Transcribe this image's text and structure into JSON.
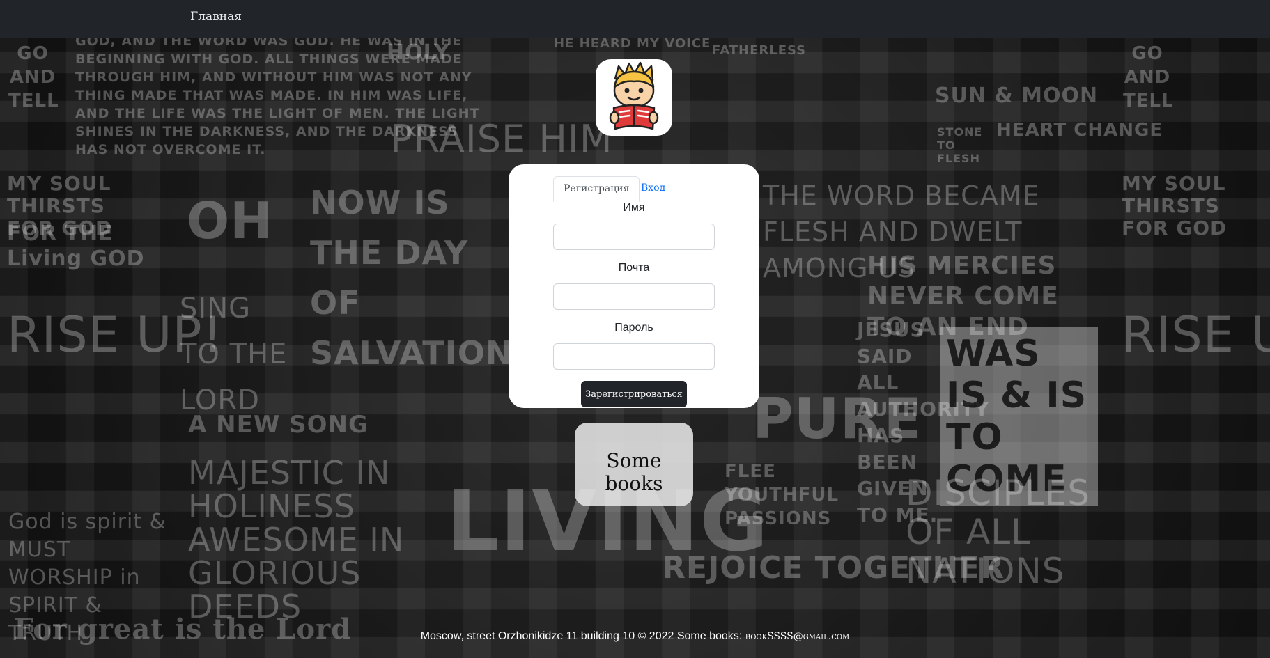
{
  "navbar": {
    "home_label": "Главная"
  },
  "background_text": [
    "GO AND TELL",
    "GOD, AND THE WORD WAS GOD. HE WAS IN THE",
    "BEGINNING WITH GOD. ALL THINGS WERE MADE",
    "THROUGH HIM, AND WITHOUT HIM WAS NOT ANY",
    "THING MADE THAT WAS MADE. IN HIM WAS LIFE,",
    "AND THE LIFE WAS THE LIGHT OF MEN. THE LIGHT",
    "SHINES IN THE DARKNESS, AND THE DARKNESS",
    "HAS NOT OVERCOME IT.",
    "HOLY",
    "HE HEARD MY VOICE",
    "FATHERLESS",
    "PRAISE HIM",
    "SUN & MOON",
    "HEART CHANGE",
    "STONE TO FLESH",
    "MY SOUL THIRSTS FOR GOD",
    "FOR THE Living GOD",
    "OH",
    "NOW IS THE DAY OF SALVATION",
    "THE WORD BECAME FLESH AND DWELT AMONG US",
    "HIS MERCIES NEVER COME TO AN END",
    "RISE UP!",
    "SING TO THE LORD",
    "A NEW SONG",
    "JESUS SAID ALL AUTHORITY HAS BEEN GIVEN TO ME.",
    "WAS IS & IS TO COME",
    "PURE",
    "MAJESTIC IN HOLINESS AWESOME IN GLORIOUS DEEDS",
    "LIVING",
    "FLEE YOUTHFUL PASSIONS",
    "REJOICE TOGETHER",
    "DISCIPLES OF ALL NATIONS",
    "God is spirit & MUST WORSHIP in SPIRIT & TRUTH",
    "For great is the Lord"
  ],
  "form": {
    "tabs": [
      {
        "label": "Регистрация",
        "active": true
      },
      {
        "label": "Вход",
        "active": false
      }
    ],
    "fields": [
      {
        "label": "Имя",
        "value": ""
      },
      {
        "label": "Почта",
        "value": ""
      },
      {
        "label": "Пароль",
        "value": ""
      }
    ],
    "submit_label": "Зарегистрироваться"
  },
  "brand": {
    "name": "Some books"
  },
  "footer": {
    "text": "Moscow, street Orzhonikidze 11 building 10 © 2022 Some books:",
    "email": "bookSSSS@gmail.com"
  },
  "colors": {
    "navbar": "#212529",
    "link": "#0d6efd",
    "button": "#212529",
    "card": "#ffffff"
  },
  "icons": {
    "logo": "boy-reading-book-icon"
  }
}
